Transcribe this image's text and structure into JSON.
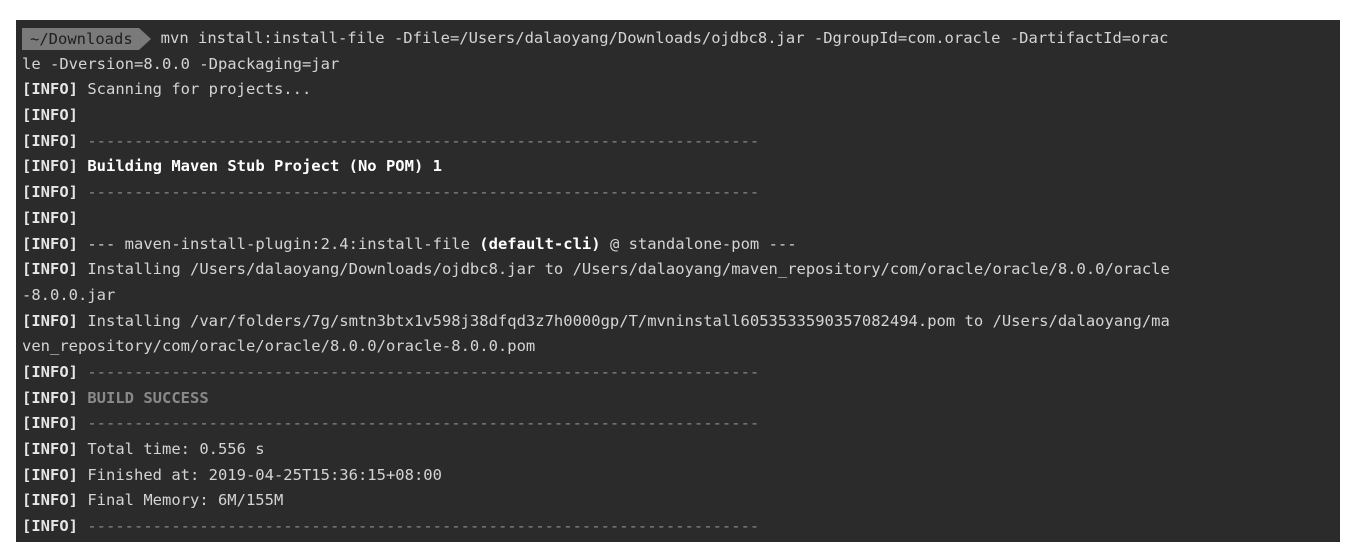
{
  "terminal": {
    "prompt_dir": "~/Downloads",
    "command_l1": "mvn install:install-file -Dfile=/Users/dalaoyang/Downloads/ojdbc8.jar -DgroupId=com.oracle -DartifactId=orac",
    "command_l2": "le -Dversion=8.0.0 -Dpackaging=jar",
    "tag": "[INFO]",
    "separator": "------------------------------------------------------------------------",
    "scanning": " Scanning for projects...",
    "building": "Building Maven Stub Project (No POM) 1",
    "plugin_prefix": "--- maven-install-plugin:2.4:install-file ",
    "plugin_bold": "(default-cli)",
    "plugin_suffix": " @ standalone-pom ---",
    "installing_1a": " Installing /Users/dalaoyang/Downloads/ojdbc8.jar to /Users/dalaoyang/maven_repository/com/oracle/oracle/8.0.0/oracle",
    "installing_1b": "-8.0.0.jar",
    "installing_2a": " Installing /var/folders/7g/smtn3btx1v598j38dfqd3z7h0000gp/T/mvninstall6053533590357082494.pom to /Users/dalaoyang/ma",
    "installing_2b": "ven_repository/com/oracle/oracle/8.0.0/oracle-8.0.0.pom",
    "build_success": "BUILD SUCCESS",
    "total_time": " Total time: 0.556 s",
    "finished_at": " Finished at: 2019-04-25T15:36:15+08:00",
    "final_memory": " Final Memory: 6M/155M"
  }
}
